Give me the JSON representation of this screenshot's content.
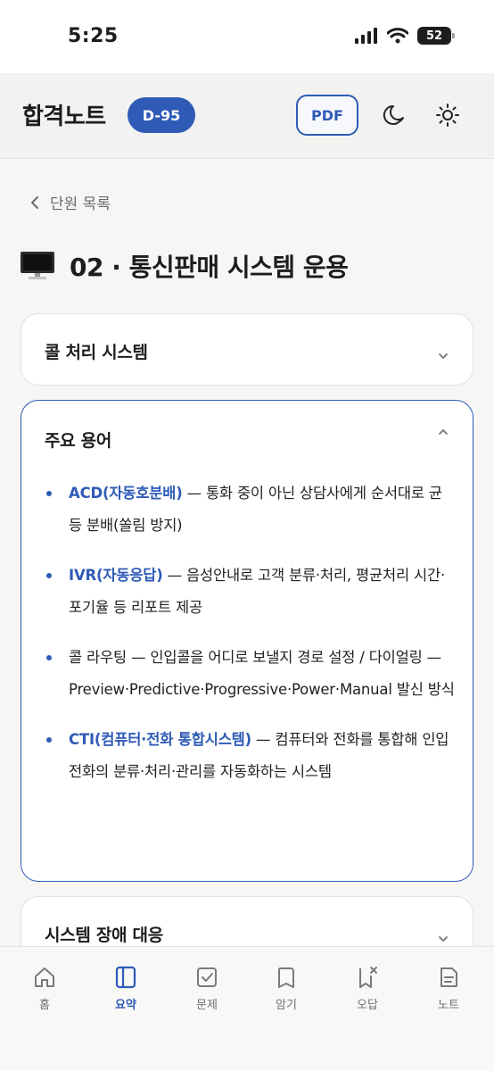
{
  "status": {
    "time": "5:25",
    "battery": "52"
  },
  "header": {
    "title": "합격노트",
    "dday": "D-95",
    "pdf_label": "PDF"
  },
  "breadcrumb": {
    "label": "단원 목록"
  },
  "page": {
    "title": "02 · 통신판매 시스템 운용",
    "icon": "computer-icon"
  },
  "sections": [
    {
      "title": "콜 처리 시스템",
      "expanded": false
    },
    {
      "title": "주요 용어",
      "expanded": true,
      "items": [
        {
          "term": "ACD(자동호분배)",
          "desc": " — 통화 중이 아닌 상담사에게 순서대로 균등 분배(쏠림 방지)"
        },
        {
          "term": "IVR(자동응답)",
          "desc": " — 음성안내로 고객 분류·처리, 평균처리 시간·포기율 등 리포트 제공"
        },
        {
          "term": "",
          "desc": "콜 라우팅 — 인입콜을 어디로 보낼지 경로 설정 / 다이얼링 — Preview·Predictive·Progressive·Power·Manual 발신 방식"
        },
        {
          "term": "CTI(컴퓨터·전화 통합시스템)",
          "desc": " — 컴퓨터와 전화를 통합해 인입 전화의 분류·처리·관리를 자동화하는 시스템"
        }
      ]
    },
    {
      "title": "시스템 장애 대응",
      "expanded": false
    }
  ],
  "tabs": [
    {
      "label": "홈",
      "icon": "home-icon",
      "active": false
    },
    {
      "label": "요약",
      "icon": "summary-icon",
      "active": true
    },
    {
      "label": "문제",
      "icon": "quiz-icon",
      "active": false
    },
    {
      "label": "암기",
      "icon": "memorize-icon",
      "active": false
    },
    {
      "label": "오답",
      "icon": "wrong-answer-icon",
      "active": false
    },
    {
      "label": "노트",
      "icon": "note-icon",
      "active": false
    }
  ],
  "colors": {
    "accent": "#2f5bb7",
    "background": "#f6f6f5",
    "card": "#ffffff"
  }
}
